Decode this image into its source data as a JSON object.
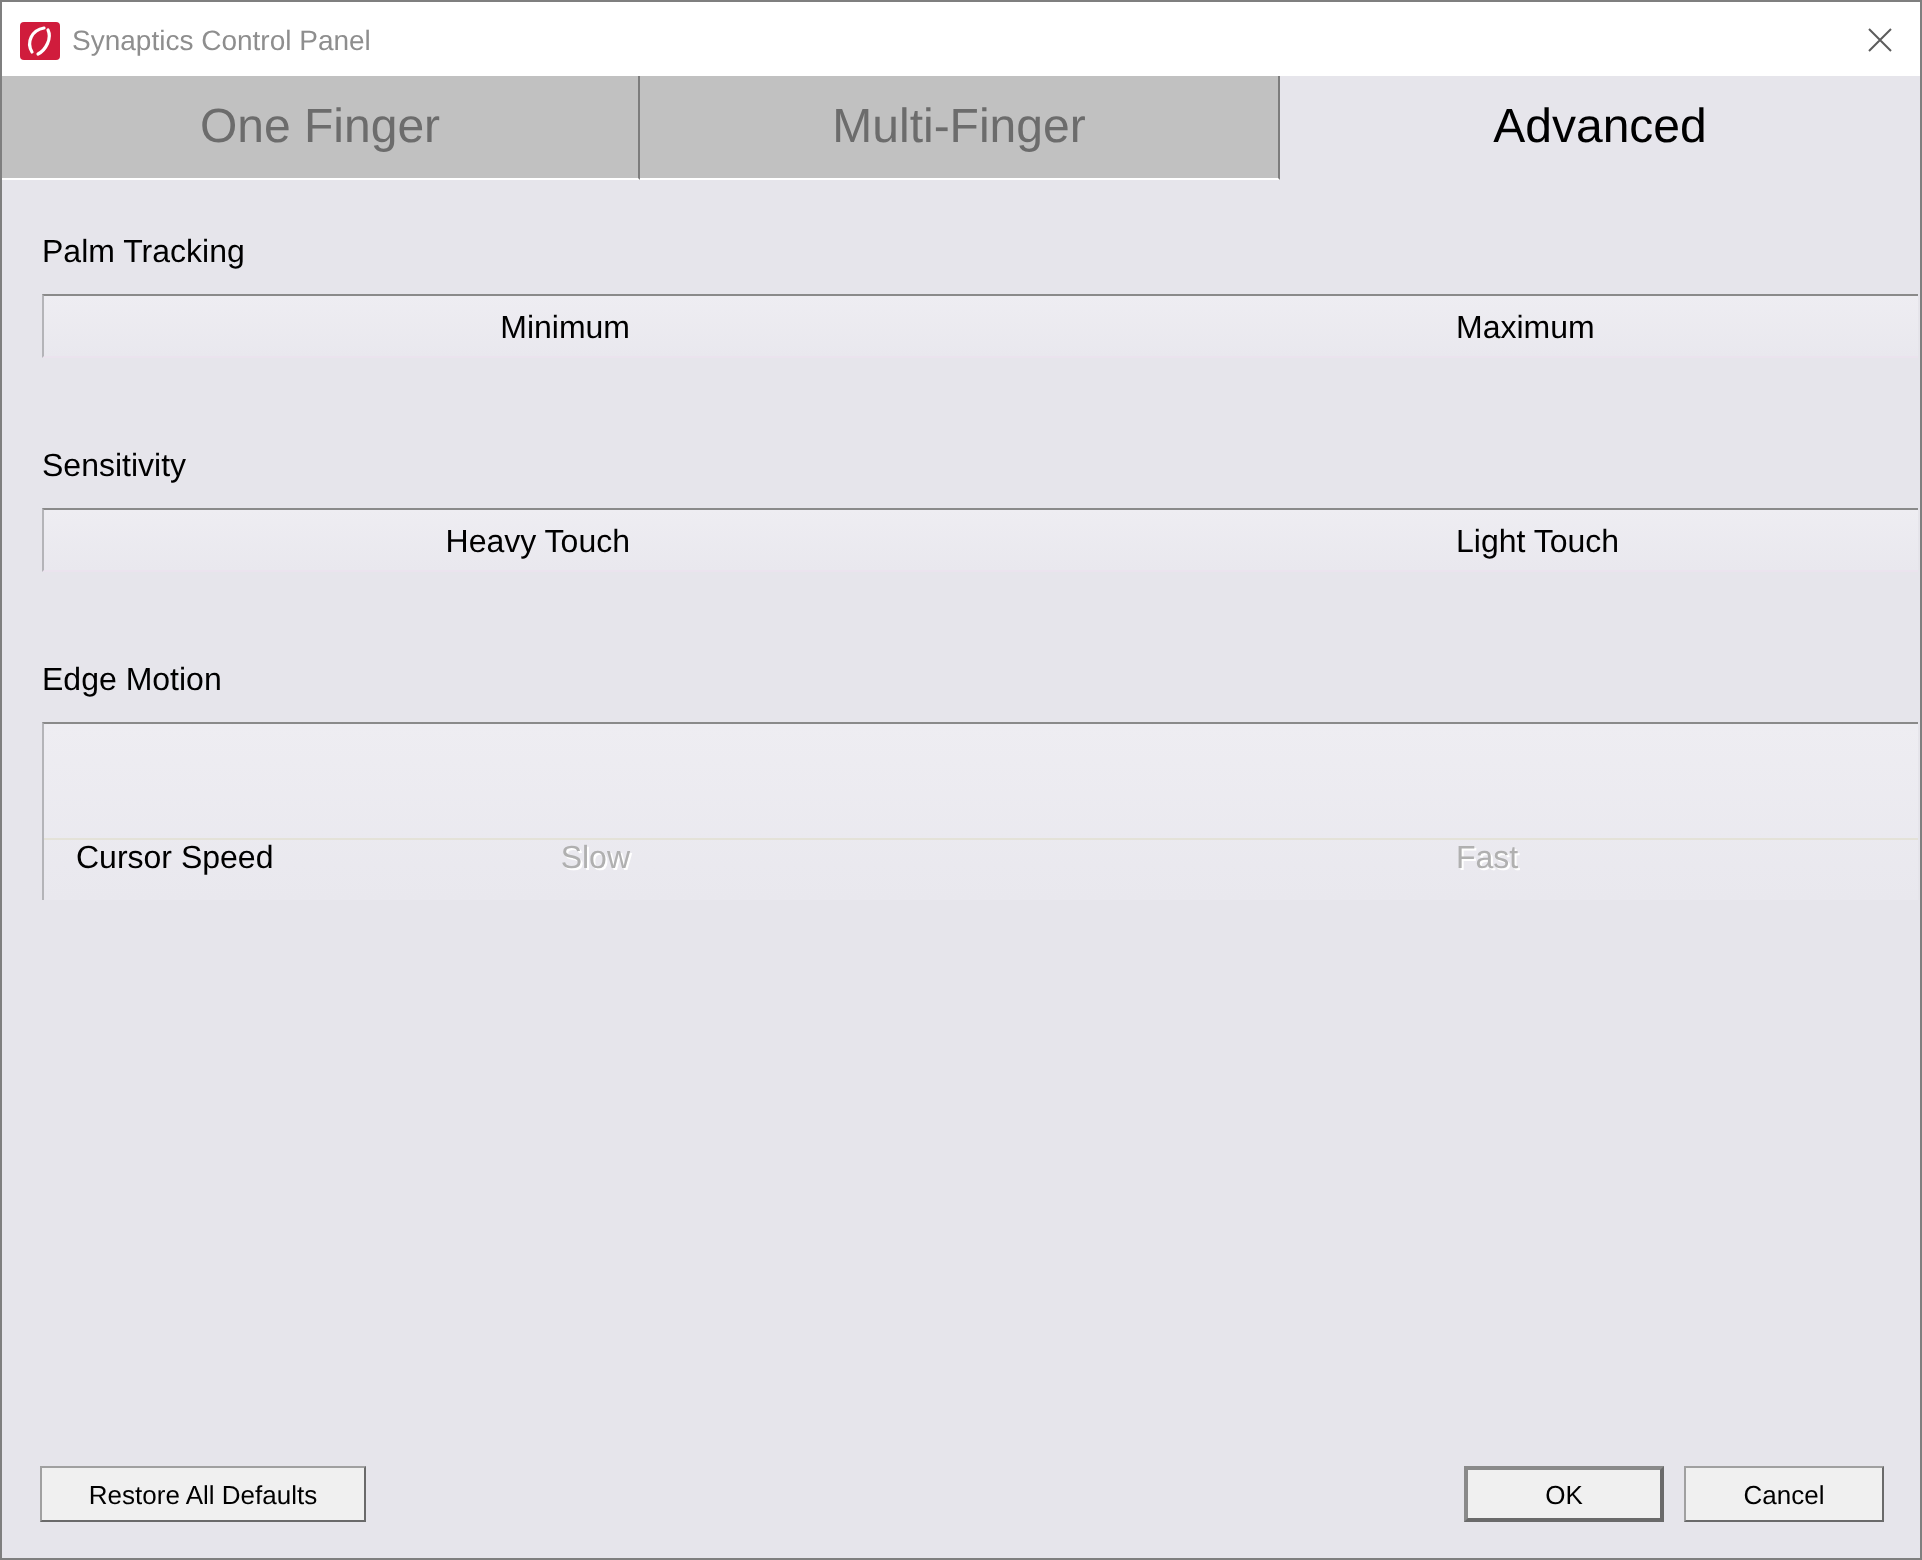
{
  "window": {
    "title": "Synaptics Control Panel"
  },
  "tabs": [
    {
      "label": "One Finger",
      "selected": false
    },
    {
      "label": "Multi-Finger",
      "selected": false
    },
    {
      "label": "Advanced",
      "selected": true
    }
  ],
  "sections": [
    {
      "title": "Palm Tracking",
      "kind": "slider",
      "min_label": "Minimum",
      "max_label": "Maximum"
    },
    {
      "title": "Sensitivity",
      "kind": "slider",
      "min_label": "Heavy Touch",
      "max_label": "Light Touch"
    },
    {
      "title": "Edge Motion",
      "kind": "group",
      "rows": [
        {
          "label": "Cursor Speed",
          "min_label": "Slow",
          "max_label": "Fast",
          "disabled": true
        }
      ]
    }
  ],
  "footer": {
    "restore_button": "Restore All Defaults",
    "ok_button": {
      "label": "OK",
      "default": true
    },
    "cancel_button": "Cancel"
  }
}
